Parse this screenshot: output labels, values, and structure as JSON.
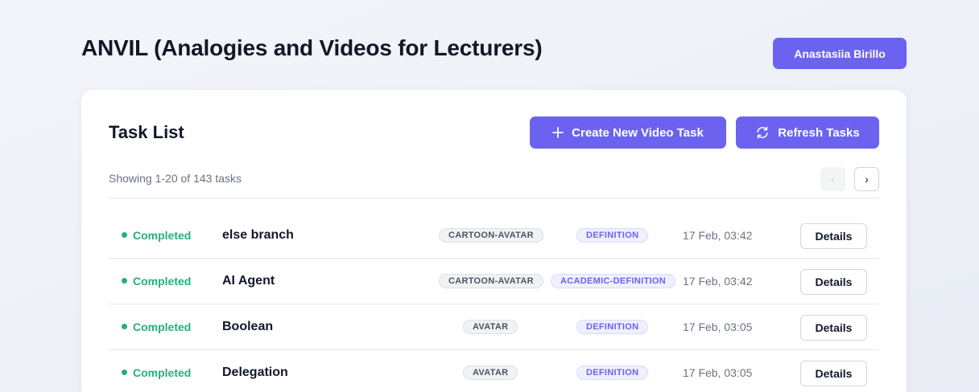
{
  "header": {
    "app_title": "ANVIL (Analogies and Videos for Lecturers)",
    "user_name": "Anastasiia Birillo"
  },
  "task_list": {
    "title": "Task List",
    "create_label": "Create New Video Task",
    "refresh_label": "Refresh Tasks",
    "showing_text": "Showing 1-20 of 143 tasks",
    "pager_prev": "‹",
    "pager_next": "›",
    "details_label": "Details",
    "rows": [
      {
        "status": "Completed",
        "name": "else branch",
        "style_tag": "CARTOON-AVATAR",
        "type_tag": "DEFINITION",
        "date": "17 Feb, 03:42"
      },
      {
        "status": "Completed",
        "name": "AI Agent",
        "style_tag": "CARTOON-AVATAR",
        "type_tag": "ACADEMIC-DEFINITION",
        "date": "17 Feb, 03:42"
      },
      {
        "status": "Completed",
        "name": "Boolean",
        "style_tag": "AVATAR",
        "type_tag": "DEFINITION",
        "date": "17 Feb, 03:05"
      },
      {
        "status": "Completed",
        "name": "Delegation",
        "style_tag": "AVATAR",
        "type_tag": "DEFINITION",
        "date": "17 Feb, 03:05"
      }
    ]
  },
  "colors": {
    "accent": "#6b63f0",
    "status_completed": "#22b07d"
  },
  "icons": {
    "create": "plus-icon",
    "refresh": "refresh-icon",
    "prev": "chevron-left-icon",
    "next": "chevron-right-icon"
  }
}
